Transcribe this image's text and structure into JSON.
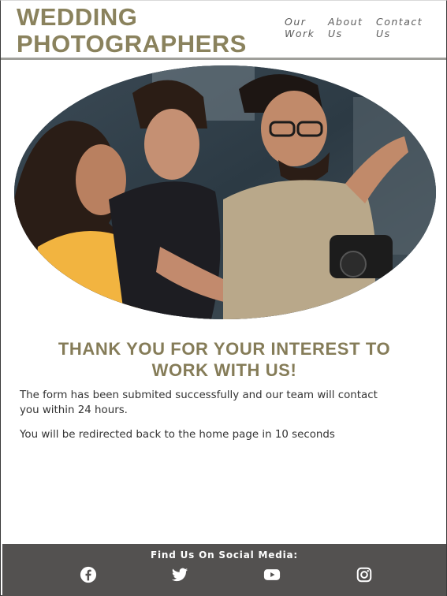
{
  "header": {
    "logo_line1": "WEDDING",
    "logo_line2": "PHOTOGRAPHERS",
    "nav": [
      {
        "line1": "Our",
        "line2": "Work"
      },
      {
        "line1": "About",
        "line2": "Us"
      },
      {
        "line1": "Contact",
        "line2": "Us"
      }
    ]
  },
  "main": {
    "heading_line1": "THANK YOU FOR YOUR INTEREST TO",
    "heading_line2": "WORK WITH US!",
    "message_line1": "The form has been submited successfully and our team will contact",
    "message_line2": "you within 24 hours.",
    "redirect": "You will be redirected back to the home page in 10 seconds"
  },
  "footer": {
    "title": "Find Us On Social Media:",
    "icons": [
      "facebook-icon",
      "twitter-icon",
      "youtube-icon",
      "instagram-icon"
    ]
  },
  "colors": {
    "brand": "#8a825d",
    "footer_bg": "#535150",
    "text": "#333333"
  }
}
